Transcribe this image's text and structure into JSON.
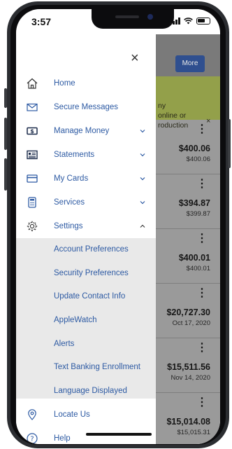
{
  "status": {
    "time": "3:57"
  },
  "background": {
    "more_button": "More",
    "banner": {
      "lines": [
        "ny",
        "online or",
        "roduction"
      ],
      "close": "×"
    },
    "accounts": [
      {
        "amount": "$400.06",
        "sub": "$400.06"
      },
      {
        "amount": "$394.87",
        "sub": "$399.87"
      },
      {
        "amount": "$400.01",
        "sub": "$400.01"
      },
      {
        "amount": "$20,727.30",
        "sub": "Oct 17, 2020"
      },
      {
        "amount": "$15,511.56",
        "sub": "Nov 14, 2020"
      },
      {
        "amount": "$15,014.08",
        "sub": "$15,015.31"
      }
    ]
  },
  "menu": {
    "close": "×",
    "items": [
      {
        "label": "Home",
        "icon": "home-icon"
      },
      {
        "label": "Secure Messages",
        "icon": "envelope-icon"
      },
      {
        "label": "Manage Money",
        "icon": "money-icon"
      },
      {
        "label": "Statements",
        "icon": "statement-icon"
      },
      {
        "label": "My Cards",
        "icon": "card-icon"
      },
      {
        "label": "Services",
        "icon": "calculator-icon"
      },
      {
        "label": "Settings",
        "icon": "gear-icon"
      }
    ],
    "settings_sub": [
      "Account Preferences",
      "Security Preferences",
      "Update Contact Info",
      "AppleWatch",
      "Alerts",
      "Text Banking Enrollment",
      "Language Displayed"
    ],
    "bottom": [
      {
        "label": "Locate Us",
        "icon": "location-pin-icon"
      },
      {
        "label": "Help",
        "icon": "help-icon"
      }
    ]
  },
  "colors": {
    "accent": "#2d5aa3",
    "submenu_bg": "#e9e9e9",
    "banner": "#93a04a"
  }
}
